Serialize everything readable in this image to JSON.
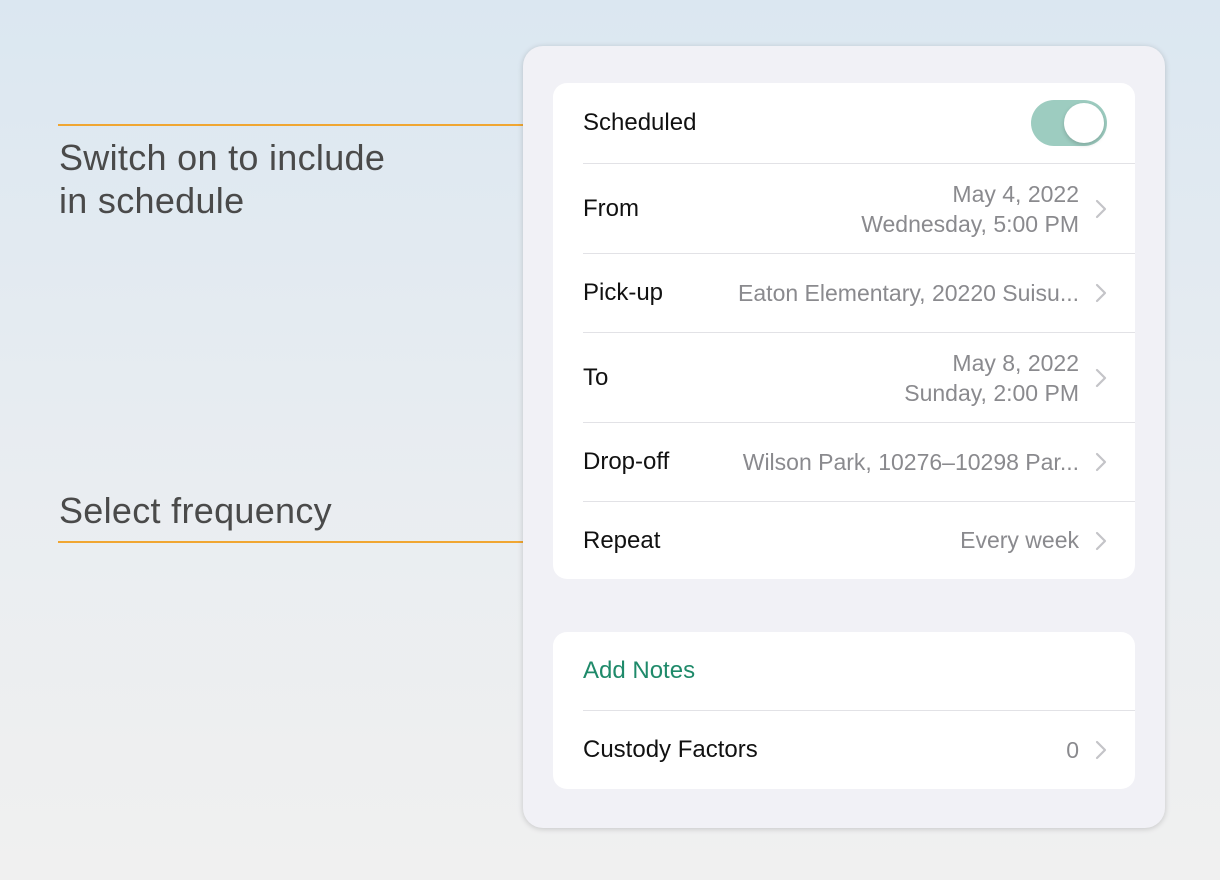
{
  "callouts": {
    "scheduled": {
      "line1": "Switch on to include",
      "line2": "in schedule"
    },
    "repeat": {
      "text": "Select frequency"
    },
    "accent_color": "#f0a632"
  },
  "schedule_group": {
    "scheduled": {
      "label": "Scheduled",
      "toggle_on": true,
      "toggle_color": "#9dccc0"
    },
    "from": {
      "label": "From",
      "date": "May 4, 2022",
      "time": "Wednesday, 5:00 PM"
    },
    "pickup": {
      "label": "Pick-up",
      "value": "Eaton Elementary, 20220 Suisu..."
    },
    "to": {
      "label": "To",
      "date": "May 8, 2022",
      "time": "Sunday, 2:00 PM"
    },
    "dropoff": {
      "label": "Drop-off",
      "value": "Wilson Park, 10276–10298 Par..."
    },
    "repeat": {
      "label": "Repeat",
      "value": "Every week"
    }
  },
  "notes_group": {
    "add_notes": {
      "label": "Add Notes",
      "color": "#1f8a6a"
    },
    "custody_factors": {
      "label": "Custody Factors",
      "value": "0"
    }
  },
  "icons": {
    "chevron": "chevron-right-icon"
  }
}
